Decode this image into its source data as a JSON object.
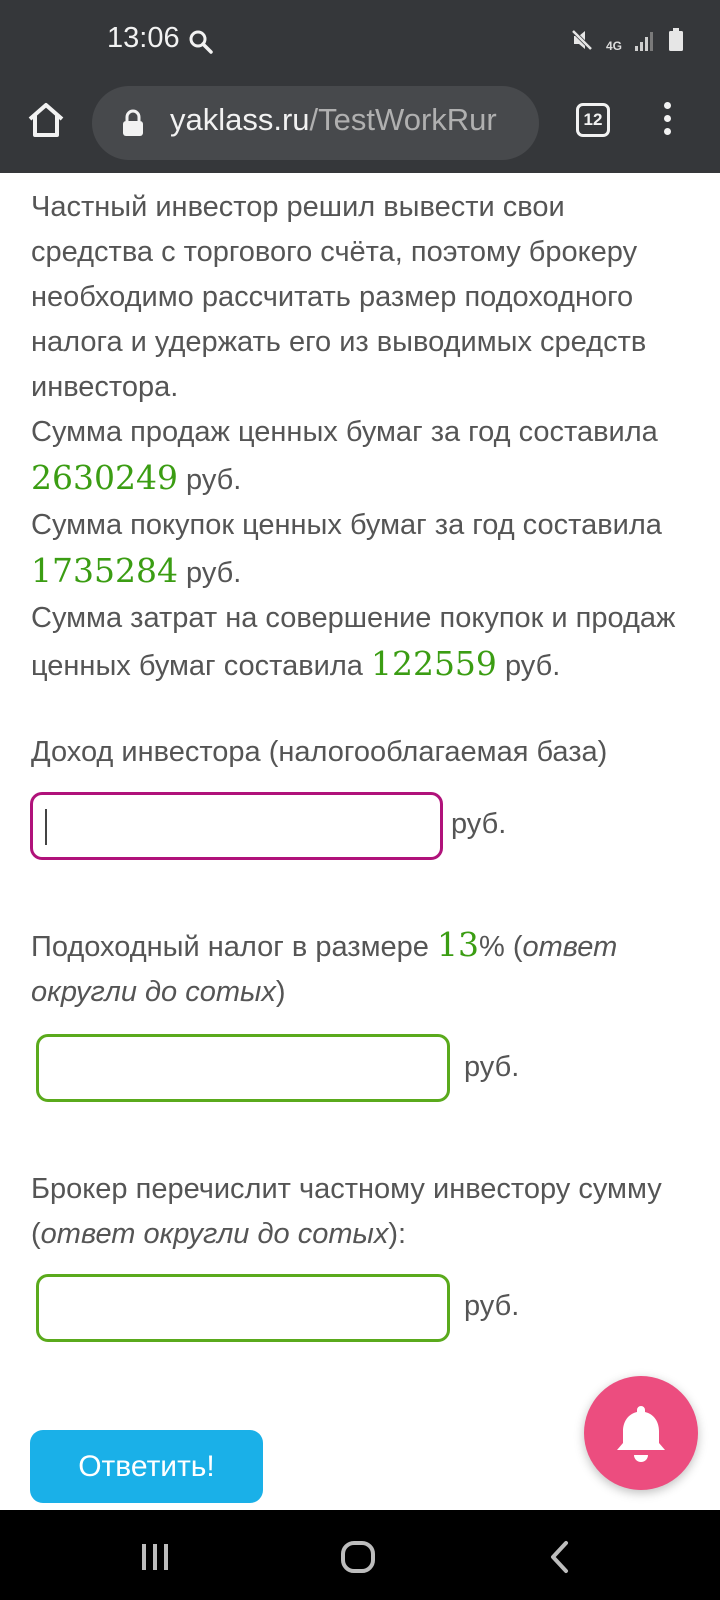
{
  "status_bar": {
    "time": "13:06",
    "network": "4G"
  },
  "browser": {
    "url_domain": "yaklass.ru",
    "url_path": "/TestWorkRur",
    "tab_count": "12"
  },
  "problem": {
    "intro": "Частный инвестор решил вывести свои средства с торгового счёта, поэтому брокеру необходимо рассчитать размер подоходного налога и удержать его из выводимых средств инвестора.",
    "sales_prefix": "Сумма продаж ценных бумаг за год составила",
    "sales_value": "2630249",
    "purchases_prefix": "Сумма покупок ценных бумаг за год составила",
    "purchases_value": "1735284",
    "costs_prefix": "Сумма затрат на совершение покупок и продаж ценных бумаг составила",
    "costs_value": "122559",
    "currency": "руб."
  },
  "questions": {
    "income_label": "Доход инвестора (налогооблагаемая база)",
    "tax_prefix": "Подоходный налог в размере",
    "tax_rate": "13",
    "tax_percent": "% (",
    "tax_hint": "ответ округли до сотых",
    "tax_close": ")",
    "transfer_prefix": "Брокер перечислит частному инвестору сумму (",
    "transfer_hint": "ответ округли до сотых",
    "transfer_close": "):",
    "unit": "руб."
  },
  "inputs": {
    "income_value": "",
    "tax_value": "",
    "transfer_value": ""
  },
  "submit_label": "Ответить!",
  "icons": {
    "home": "home-icon",
    "lock": "lock-icon",
    "menu": "kebab-menu-icon",
    "bell": "bell-icon"
  },
  "colors": {
    "accent_green": "#3b9d13",
    "active_border": "#b0127a",
    "submit": "#1ab0e8",
    "bell": "#ec4d7f"
  }
}
